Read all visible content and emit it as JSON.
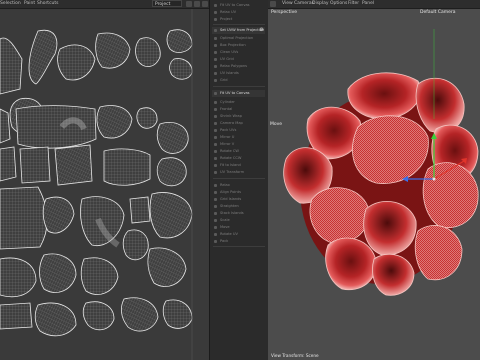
{
  "uv_editor": {
    "menu": [
      "Selection",
      "Paint",
      "Shortcuts"
    ],
    "project_select": "Project"
  },
  "commands": {
    "group1": [
      "Fit UV to Canvas",
      "Relax UV",
      "Project",
      "Optimal Projection",
      "Box Projection",
      "Clean UVs",
      "UV Grid",
      "Relax Polygons"
    ],
    "set_uvw": "Set UVW from Projection",
    "group2": [
      "UV Islands",
      "Grid",
      "Cylinder",
      "Frontal",
      "Shrink Wrap",
      "Camera Map",
      "Pack UVs"
    ],
    "fit_uv": "Fit UV to Canvas",
    "group3": [
      "Mirror U",
      "Mirror V",
      "Rotate CW",
      "Rotate CCW",
      "Fit to Island",
      "UV Transform",
      "Relax",
      "Align Points",
      "Grid Islands",
      "Straighten",
      "Stack Islands",
      "Scale",
      "Move",
      "Rotate UV",
      "Pack",
      "Reset",
      "UV Tools",
      "Layout",
      "Normalize",
      "Options",
      "Settings"
    ]
  },
  "viewport": {
    "menu": [
      "View",
      "Cameras",
      "Display",
      "Options",
      "Filter",
      "Panel"
    ],
    "perspective": "Perspective",
    "camera": "Default Camera",
    "move_label": "Move",
    "footer": "View Transform: Scene"
  },
  "colors": {
    "uv_background": "#3a3a3a",
    "uv_wire": "#e8e8e8",
    "viewport_bg": "#4c4c4c",
    "flower_red": "#d9383a",
    "gizmo_x": "#e0342b",
    "gizmo_y": "#3bd13b",
    "gizmo_z": "#3a6ee8"
  }
}
